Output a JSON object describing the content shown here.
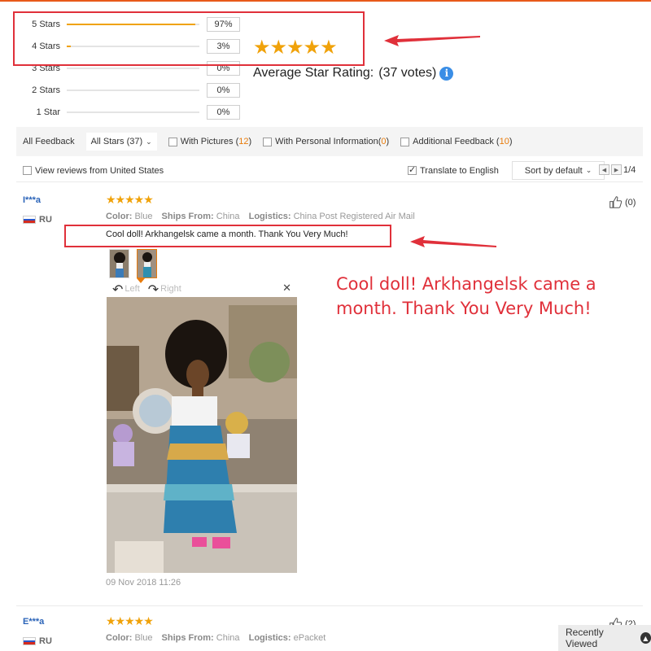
{
  "rating_summary": {
    "rows": [
      {
        "label": "5 Stars",
        "percent_text": "97%",
        "fill": 0.97
      },
      {
        "label": "4 Stars",
        "percent_text": "3%",
        "fill": 0.03
      },
      {
        "label": "3 Stars",
        "percent_text": "0%",
        "fill": 0
      },
      {
        "label": "2 Stars",
        "percent_text": "0%",
        "fill": 0
      },
      {
        "label": "1 Star",
        "percent_text": "0%",
        "fill": 0
      }
    ],
    "average_stars": "★★★★★",
    "average_label": "Average Star Rating:",
    "votes": "(37 votes)",
    "info_icon": "i"
  },
  "filter_bar": {
    "all_feedback": "All Feedback",
    "all_stars": "All Stars (37)",
    "with_pictures_label": "With Pictures (",
    "with_pictures_count": "12",
    "with_personal_label": "With Personal Information(",
    "with_personal_count": "0",
    "additional_label": "Additional Feedback (",
    "additional_count": "10",
    "close_paren": ")"
  },
  "second_bar": {
    "view_us": "View reviews from United States",
    "translate": "Translate to English",
    "translate_checked": true,
    "sort": "Sort by default",
    "page": "1/4"
  },
  "reviews": [
    {
      "name": "I***a",
      "country": "RU",
      "stars": "★★★★★",
      "color_label": "Color:",
      "color": "Blue",
      "ships_label": "Ships From:",
      "ships": "China",
      "logistics_label": "Logistics:",
      "logistics": "China Post Registered Air Mail",
      "text": "Cool doll! Arkhangelsk came a month. Thank You Very Much!",
      "helpful": "(0)",
      "viewer_left": "Left",
      "viewer_right": "Right",
      "date": "09 Nov 2018 11:26"
    },
    {
      "name": "E***a",
      "country": "RU",
      "stars": "★★★★★",
      "color_label": "Color:",
      "color": "Blue",
      "ships_label": "Ships From:",
      "ships": "China",
      "logistics_label": "Logistics:",
      "logistics": "ePacket",
      "helpful": "(2)"
    }
  ],
  "annotation_text": "Cool doll! Arkhangelsk came a month. Thank You Very Much!",
  "recently_viewed": "Recently Viewed",
  "colors": {
    "star": "#f0a20a",
    "annotation_red": "#e0303a",
    "link_blue": "#2a63b8",
    "count_orange": "#e87b0b"
  }
}
